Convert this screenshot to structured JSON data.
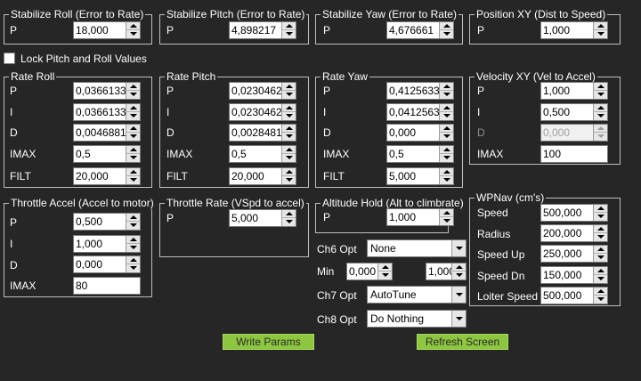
{
  "stabilize_roll": {
    "title": "Stabilize Roll (Error to Rate)",
    "p_label": "P",
    "p": "18,000"
  },
  "stabilize_pitch": {
    "title": "Stabilize Pitch (Error to Rate)",
    "p_label": "P",
    "p": "4,898217"
  },
  "stabilize_yaw": {
    "title": "Stabilize Yaw (Error to Rate)",
    "p_label": "P",
    "p": "4,676661"
  },
  "position_xy": {
    "title": "Position XY (Dist to Speed)",
    "p_label": "P",
    "p": "1,000"
  },
  "lock_pitch_roll": {
    "label": "Lock Pitch and Roll Values",
    "checked": false
  },
  "rate_roll": {
    "title": "Rate Roll",
    "p_label": "P",
    "p": "0,03661337",
    "i_label": "I",
    "i": "0,03661337",
    "d_label": "D",
    "d": "0,00468813",
    "imax_label": "IMAX",
    "imax": "0,5",
    "filt_label": "FILT",
    "filt": "20,000"
  },
  "rate_pitch": {
    "title": "Rate Pitch",
    "p_label": "P",
    "p": "0,0230462",
    "i_label": "I",
    "i": "0,0230462",
    "d_label": "D",
    "d": "0,00284810",
    "imax_label": "IMAX",
    "imax": "0,5",
    "filt_label": "FILT",
    "filt": "20,000"
  },
  "rate_yaw": {
    "title": "Rate Yaw",
    "p_label": "P",
    "p": "0,4125633",
    "i_label": "I",
    "i": "0,04125633",
    "d_label": "D",
    "d": "0,000",
    "imax_label": "IMAX",
    "imax": "0,5",
    "filt_label": "FILT",
    "filt": "5,000"
  },
  "velocity_xy": {
    "title": "Velocity XY (Vel to Accel)",
    "p_label": "P",
    "p": "1,000",
    "i_label": "I",
    "i": "0,500",
    "d_label": "D",
    "d": "0,000",
    "imax_label": "IMAX",
    "imax": "100"
  },
  "throttle_accel": {
    "title": "Throttle Accel (Accel to motor)",
    "p_label": "P",
    "p": "0,500",
    "i_label": "I",
    "i": "1,000",
    "d_label": "D",
    "d": "0,000",
    "imax_label": "IMAX",
    "imax": "80"
  },
  "throttle_rate": {
    "title": "Throttle Rate (VSpd to accel)",
    "p_label": "P",
    "p": "5,000"
  },
  "altitude_hold": {
    "title": "Altitude Hold (Alt to climbrate)",
    "p_label": "P",
    "p": "1,000"
  },
  "ch6": {
    "label": "Ch6 Opt",
    "value": "None",
    "min_label": "Min",
    "min": "0,000",
    "max": "1,000"
  },
  "ch7": {
    "label": "Ch7 Opt",
    "value": "AutoTune"
  },
  "ch8": {
    "label": "Ch8 Opt",
    "value": "Do Nothing"
  },
  "wpnav": {
    "title": "WPNav (cm's)",
    "speed_label": "Speed",
    "speed": "500,000",
    "radius_label": "Radius",
    "radius": "200,000",
    "speed_up_label": "Speed Up",
    "speed_up": "250,000",
    "speed_dn_label": "Speed Dn",
    "speed_dn": "150,000",
    "loiter_label": "Loiter Speed",
    "loiter": "500,000"
  },
  "buttons": {
    "write": "Write Params",
    "refresh": "Refresh Screen"
  },
  "colors": {
    "background": "#262626",
    "button": "#8dc63f",
    "border": "#bfbfbf"
  }
}
